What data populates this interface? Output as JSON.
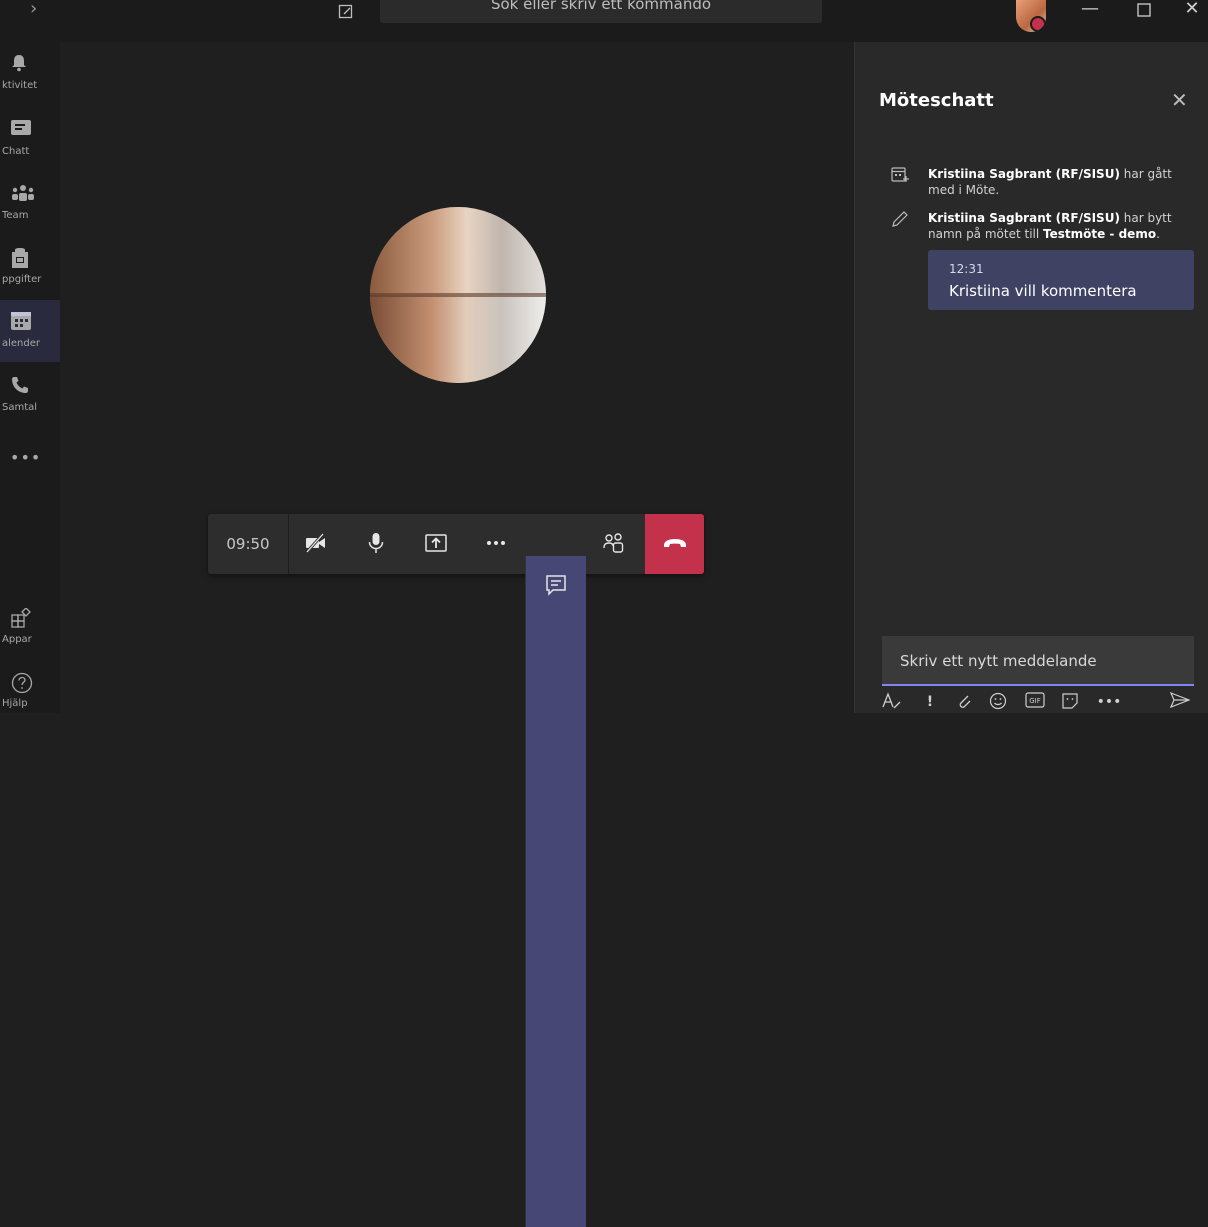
{
  "titlebar": {
    "search_placeholder": "Sök eller skriv ett kommando"
  },
  "rail": {
    "items": [
      {
        "label": "ktivitet",
        "icon": "bell-icon"
      },
      {
        "label": "Chatt",
        "icon": "chat-icon"
      },
      {
        "label": "Team",
        "icon": "teams-icon"
      },
      {
        "label": "ppgifter",
        "icon": "assignments-icon"
      },
      {
        "label": "alender",
        "icon": "calendar-icon"
      },
      {
        "label": "Samtal",
        "icon": "phone-icon"
      }
    ],
    "more": "•••",
    "bottom": [
      {
        "label": "Appar",
        "icon": "apps-icon"
      },
      {
        "label": "Hjälp",
        "icon": "help-icon"
      }
    ]
  },
  "call": {
    "timer": "09:50"
  },
  "colors": {
    "accent": "#464775",
    "hangup": "#c4314b",
    "compose_underline": "#7f85f5"
  },
  "chat": {
    "title": "Möteschatt",
    "events": [
      {
        "name": "Kristiina Sagbrant (RF/SISU)",
        "text": " har gått med i Möte.",
        "icon": "calendar-add-icon"
      },
      {
        "name": "Kristiina Sagbrant (RF/SISU)",
        "text_a": " har bytt namn på mötet till ",
        "meeting": "Testmöte - demo",
        "text_b": ".",
        "icon": "pencil-icon"
      }
    ],
    "message": {
      "time": "12:31",
      "text": "Kristiina vill kommentera"
    },
    "compose_placeholder": "Skriv ett nytt meddelande",
    "tools": {
      "gif": "GIF",
      "more": "•••"
    }
  }
}
